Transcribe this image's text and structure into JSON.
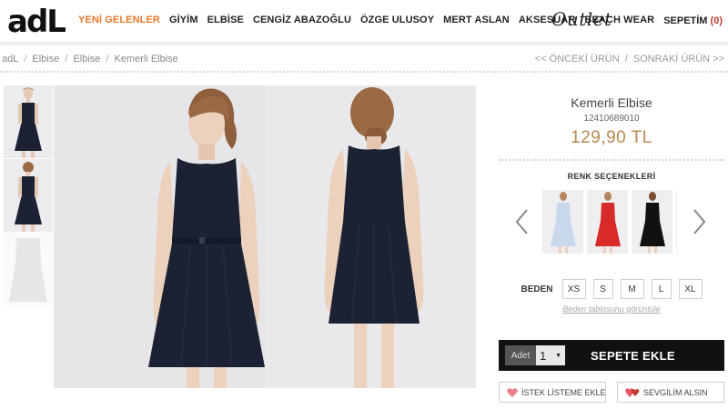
{
  "header": {
    "logo": "adL",
    "nav": [
      "YENİ GELENLER",
      "GİYİM",
      "ELBİSE",
      "CENGİZ ABAZOĞLU",
      "ÖZGE ULUSOY",
      "MERT ASLAN",
      "AKSESUAR",
      "BEACH WEAR"
    ],
    "outlet": "Outlet",
    "cart_label": "SEPETİM",
    "cart_count": "(0)"
  },
  "breadcrumb": [
    "adL",
    "Elbise",
    "Elbise",
    "Kemerli Elbise"
  ],
  "prevnext": {
    "prev": "<< ÖNCEKİ ÜRÜN",
    "next": "SONRAKİ ÜRÜN >>"
  },
  "product": {
    "name": "Kemerli Elbise",
    "code": "12410689010",
    "price": "129,90 TL",
    "color_title": "RENK SEÇENEKLERİ",
    "size_label": "BEDEN",
    "sizes": [
      "XS",
      "S",
      "M",
      "L",
      "XL"
    ],
    "size_chart": "Beden tablosunu görüntüle",
    "qty_label": "Adet",
    "qty_value": "1",
    "add_to_cart": "SEPETE EKLE",
    "wishlist": "İSTEK LİSTEME EKLE",
    "gift": "SEVGİLİM ALSIN"
  },
  "colors": {
    "accent_orange": "#e8782a",
    "price": "#b8884f",
    "dress_navy": "#1c2233",
    "swatch_light_blue": "#c9d8ea",
    "swatch_red": "#d92a2a",
    "swatch_black": "#111111",
    "heart_pink": "#e87e8a"
  },
  "icons": {
    "prev_arrow": "chevron-left-icon",
    "next_arrow": "chevron-right-icon",
    "dropdown": "caret-down-icon",
    "heart": "heart-icon",
    "gift_hearts": "double-heart-icon"
  }
}
